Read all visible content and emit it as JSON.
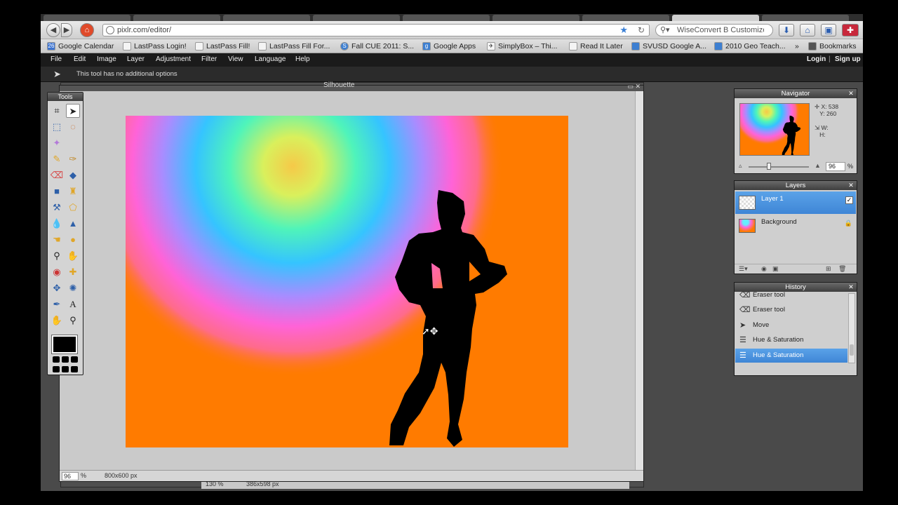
{
  "browser": {
    "url": "pixlr.com/editor/",
    "search_text": "WiseConvert B Customize",
    "bookmarks": [
      {
        "label": "Google Calendar",
        "icon": "calendar-icon",
        "color": "#3d74d1"
      },
      {
        "label": "LastPass Login!",
        "icon": "page-icon",
        "color": "#f4f4f4"
      },
      {
        "label": "LastPass Fill!",
        "icon": "page-icon",
        "color": "#f4f4f4"
      },
      {
        "label": "LastPass Fill For...",
        "icon": "page-icon",
        "color": "#f4f4f4"
      },
      {
        "label": "Fall CUE 2011: S...",
        "icon": "s-icon",
        "color": "#3d7fd1"
      },
      {
        "label": "Google Apps",
        "icon": "google-icon",
        "color": "#3d7fd1"
      },
      {
        "label": "SimplyBox – Thi...",
        "icon": "simplybox-icon",
        "color": "#f4f4f4"
      },
      {
        "label": "Read It Later",
        "icon": "page-icon",
        "color": "#f4f4f4"
      },
      {
        "label": "SVUSD Google A...",
        "icon": "svusd-icon",
        "color": "#3d7fd1"
      },
      {
        "label": "2010 Geo Teach...",
        "icon": "geo-icon",
        "color": "#3d7fd1"
      }
    ],
    "overflow_label": "»",
    "bookmarks_folder": "Bookmarks"
  },
  "menu": {
    "items": [
      "File",
      "Edit",
      "Image",
      "Layer",
      "Adjustment",
      "Filter",
      "View",
      "Language",
      "Help"
    ],
    "login": "Login",
    "separator": "|",
    "signup": "Sign up"
  },
  "options_bar": {
    "message": "This tool has no additional options"
  },
  "document": {
    "title": "Silhouette",
    "zoom": "96",
    "zoom_unit": "%",
    "size": "800x600 px"
  },
  "document2": {
    "zoom": "130",
    "zoom_unit": "%",
    "size": "386x598 px"
  },
  "tools_panel": {
    "title": "Tools",
    "foreground_color": "#000000"
  },
  "navigator": {
    "title": "Navigator",
    "x_label": "X:",
    "x_value": "538",
    "y_label": "Y:",
    "y_value": "260",
    "w_label": "W:",
    "h_label": "H:",
    "zoom": "96",
    "zoom_unit": "%"
  },
  "layers": {
    "title": "Layers",
    "items": [
      {
        "name": "Layer 1",
        "selected": true,
        "visible": true
      },
      {
        "name": "Background",
        "selected": false,
        "locked": true
      }
    ]
  },
  "history": {
    "title": "History",
    "items": [
      {
        "label": "Eraser tool",
        "icon": "eraser-icon",
        "selected": false
      },
      {
        "label": "Eraser tool",
        "icon": "eraser-icon",
        "selected": false
      },
      {
        "label": "Move",
        "icon": "move-icon",
        "selected": false
      },
      {
        "label": "Hue & Saturation",
        "icon": "adjustment-icon",
        "selected": false
      },
      {
        "label": "Hue & Saturation",
        "icon": "adjustment-icon",
        "selected": true
      }
    ]
  },
  "colors": {
    "canvas_orange": "#ff7b00",
    "selection_blue": "#4a94dd"
  }
}
